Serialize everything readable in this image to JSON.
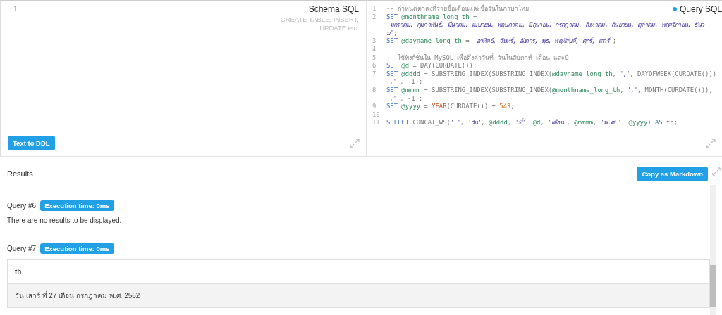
{
  "schema_panel": {
    "line_numbers": [
      "1"
    ],
    "title": "Schema SQL",
    "hint": "CREATE TABLE, INSERT, UPDATE etc.",
    "button": "Text to DDL"
  },
  "query_panel": {
    "title": "Query SQL",
    "lines": [
      {
        "number": "1",
        "segments": [
          {
            "kind": "comment",
            "text": "-- กำหนดค่าคงที่รายชื่อเดือนและชื่อวันในภาษาไทย"
          }
        ]
      },
      {
        "number": "2",
        "segments": [
          {
            "kind": "keyword",
            "text": "SET"
          },
          {
            "kind": "variable",
            "text": " @monthname_long_th"
          },
          {
            "kind": "plain",
            "text": " ="
          }
        ]
      },
      {
        "segments": [
          {
            "kind": "string",
            "text": "'มกราคม, กุมภาพันธ์, มีนาคม, เมษายน, พฤษภาคม, มิถุนายน, กรกฎาคม, สิงหาคม, กันยายน, ตุลาคม, พฤศจิกายน, ธันว"
          }
        ]
      },
      {
        "segments": [
          {
            "kind": "string",
            "text": "ม'"
          },
          {
            "kind": "plain",
            "text": ";"
          }
        ]
      },
      {
        "number": "3",
        "segments": [
          {
            "kind": "keyword",
            "text": "SET"
          },
          {
            "kind": "variable",
            "text": " @dayname_long_th"
          },
          {
            "kind": "plain",
            "text": " = "
          },
          {
            "kind": "string",
            "text": "'อาทิตย์, จันทร์, อังคาร, พุธ, พฤหัสบดี, ศุกร์, เสาร์'"
          },
          {
            "kind": "plain",
            "text": ";"
          }
        ]
      },
      {
        "number": "4"
      },
      {
        "number": "5",
        "segments": [
          {
            "kind": "comment",
            "text": "-- ใช้ฟังก์ชั่นใน MySQL เพื่อดึงค่าวันที่ วันในสัปดาห์ เดือน และปี"
          }
        ]
      },
      {
        "number": "6",
        "segments": [
          {
            "kind": "keyword",
            "text": "SET"
          },
          {
            "kind": "variable",
            "text": " @d"
          },
          {
            "kind": "plain",
            "text": " = DAY(CURDATE());"
          }
        ]
      },
      {
        "number": "7",
        "segments": [
          {
            "kind": "keyword",
            "text": "SET"
          },
          {
            "kind": "variable",
            "text": " @dddd"
          },
          {
            "kind": "plain",
            "text": " = SUBSTRING_INDEX(SUBSTRING_INDEX("
          },
          {
            "kind": "variable",
            "text": "@dayname_long_th"
          },
          {
            "kind": "plain",
            "text": ", "
          },
          {
            "kind": "string",
            "text": "','"
          },
          {
            "kind": "plain",
            "text": ", DAYOFWEEK(CURDATE()))"
          }
        ]
      },
      {
        "segments": [
          {
            "kind": "string",
            "text": "','"
          },
          {
            "kind": "plain",
            "text": " , -1);"
          }
        ]
      },
      {
        "number": "8",
        "segments": [
          {
            "kind": "keyword",
            "text": "SET"
          },
          {
            "kind": "variable",
            "text": " @mmmm"
          },
          {
            "kind": "plain",
            "text": " = SUBSTRING_INDEX(SUBSTRING_INDEX("
          },
          {
            "kind": "variable",
            "text": "@monthname_long_th"
          },
          {
            "kind": "plain",
            "text": ", "
          },
          {
            "kind": "string",
            "text": "','"
          },
          {
            "kind": "plain",
            "text": ", MONTH(CURDATE())),"
          }
        ]
      },
      {
        "segments": [
          {
            "kind": "string",
            "text": "','"
          },
          {
            "kind": "plain",
            "text": " , -1);"
          }
        ]
      },
      {
        "number": "9",
        "segments": [
          {
            "kind": "keyword",
            "text": "SET"
          },
          {
            "kind": "variable",
            "text": " @yyyy"
          },
          {
            "kind": "plain",
            "text": " = "
          },
          {
            "kind": "func",
            "text": "YEAR"
          },
          {
            "kind": "plain",
            "text": "(CURDATE()) + "
          },
          {
            "kind": "number",
            "text": "543"
          },
          {
            "kind": "plain",
            "text": ";"
          }
        ]
      },
      {
        "number": "10"
      },
      {
        "number": "11",
        "segments": [
          {
            "kind": "keyword",
            "text": "SELECT"
          },
          {
            "kind": "plain",
            "text": " CONCAT_WS("
          },
          {
            "kind": "string",
            "text": "' '"
          },
          {
            "kind": "plain",
            "text": ", "
          },
          {
            "kind": "string",
            "text": "'วัน'"
          },
          {
            "kind": "plain",
            "text": ", "
          },
          {
            "kind": "variable",
            "text": "@dddd"
          },
          {
            "kind": "plain",
            "text": ", "
          },
          {
            "kind": "string",
            "text": "'ที่'"
          },
          {
            "kind": "plain",
            "text": ", "
          },
          {
            "kind": "variable",
            "text": "@d"
          },
          {
            "kind": "plain",
            "text": ", "
          },
          {
            "kind": "string",
            "text": "'เดือน'"
          },
          {
            "kind": "plain",
            "text": ", "
          },
          {
            "kind": "variable",
            "text": "@mmmm"
          },
          {
            "kind": "plain",
            "text": ", "
          },
          {
            "kind": "string",
            "text": "'พ.ศ.'"
          },
          {
            "kind": "plain",
            "text": ", "
          },
          {
            "kind": "variable",
            "text": "@yyyy"
          },
          {
            "kind": "plain",
            "text": ") "
          },
          {
            "kind": "keyword",
            "text": "AS"
          },
          {
            "kind": "plain",
            "text": " th;"
          }
        ]
      }
    ]
  },
  "results": {
    "title": "Results",
    "copy_button": "Copy as Markdown",
    "queries": [
      {
        "label": "Query #6",
        "time": "Execution time: 0ms",
        "message": "There are no results to be displayed."
      },
      {
        "label": "Query #7",
        "time": "Execution time: 0ms",
        "table": {
          "columns": [
            "th"
          ],
          "rows": [
            [
              "วัน เสาร์ ที่ 27 เดือน กรกฎาคม พ.ศ. 2562"
            ]
          ]
        }
      }
    ]
  }
}
